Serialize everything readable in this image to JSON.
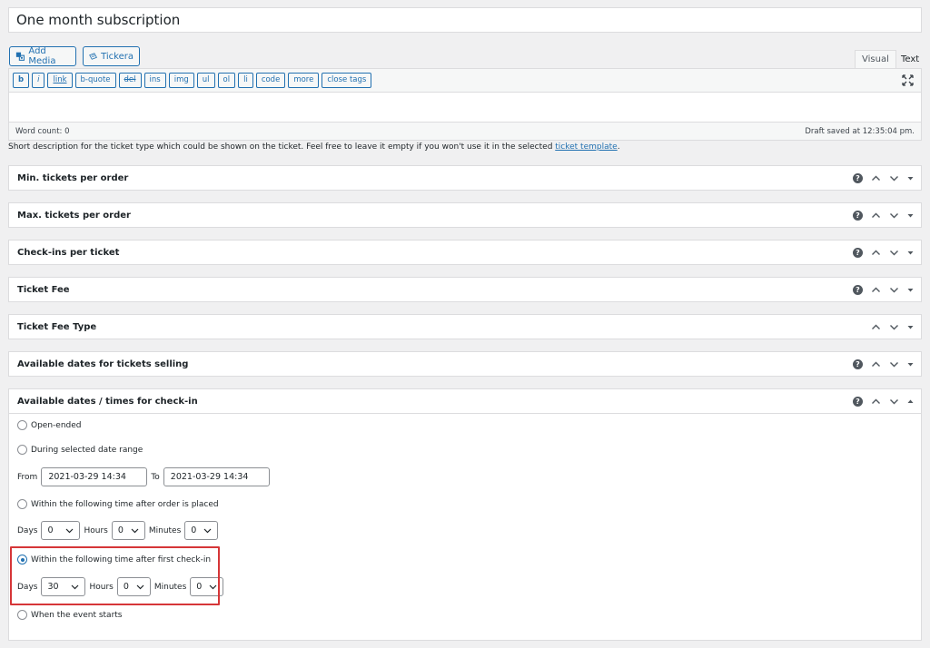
{
  "title": {
    "value": "One month subscription"
  },
  "media_buttons": {
    "add_media": "Add Media",
    "tickera": "Tickera"
  },
  "editor_tabs": {
    "visual": "Visual",
    "text": "Text"
  },
  "quicktags": [
    "b",
    "i",
    "link",
    "b-quote",
    "del",
    "ins",
    "img",
    "ul",
    "ol",
    "li",
    "code",
    "more",
    "close tags"
  ],
  "status": {
    "word_count": "Word count: 0",
    "draft_saved": "Draft saved at 12:35:04 pm."
  },
  "description": {
    "text": "Short description for the ticket type which could be shown on the ticket. Feel free to leave it empty if you won't use it in the selected ",
    "link": "ticket template",
    "end": "."
  },
  "panels": [
    {
      "title": "Min. tickets per order",
      "help": true
    },
    {
      "title": "Max. tickets per order",
      "help": true
    },
    {
      "title": "Check-ins per ticket",
      "help": true
    },
    {
      "title": "Ticket Fee",
      "help": true
    },
    {
      "title": "Ticket Fee Type",
      "help": false
    },
    {
      "title": "Available dates for tickets selling",
      "help": true
    }
  ],
  "checkin_panel": {
    "title": "Available dates / times for check-in",
    "help_glyph": "?",
    "options": {
      "open_ended": "Open-ended",
      "date_range": "During selected date range",
      "after_order": "Within the following time after order is placed",
      "after_checkin": "Within the following time after first check-in",
      "event_starts": "When the event starts"
    },
    "selected": "after_checkin",
    "from_label": "From",
    "from_value": "2021-03-29 14:34",
    "to_label": "To",
    "to_value": "2021-03-29 14:34",
    "days_label": "Days",
    "hours_label": "Hours",
    "minutes_label": "Minutes",
    "after_order_values": {
      "days": "0",
      "hours": "0",
      "minutes": "0"
    },
    "after_checkin_values": {
      "days": "30",
      "hours": "0",
      "minutes": "0"
    }
  },
  "colors": {
    "accent": "#2271b1",
    "highlight": "#d63638",
    "border": "#dcdcde"
  }
}
